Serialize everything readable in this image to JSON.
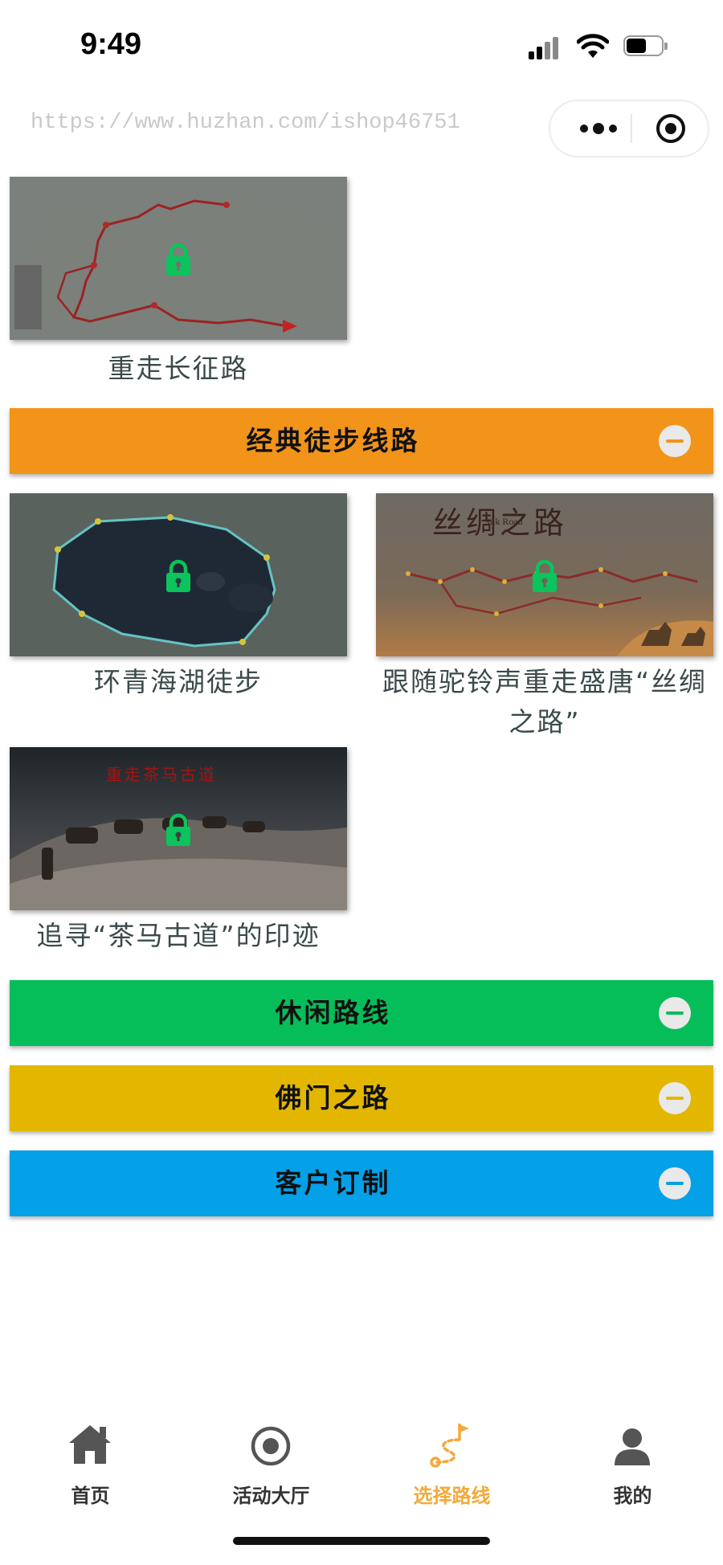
{
  "status_bar": {
    "time": "9:49"
  },
  "watermark": "https://www.huzhan.com/ishop46751",
  "sections": {
    "first_group": {
      "cards": [
        {
          "caption": "重走长征路",
          "image": "long-march-map"
        }
      ]
    },
    "hiking": {
      "title": "经典徒步线路",
      "color": "#F2941A",
      "cards": [
        {
          "caption": "环青海湖徒步",
          "image": "qinghai-lake-map"
        },
        {
          "caption": "跟随驼铃声重走盛唐“丝绸之路”",
          "image": "silk-road-map",
          "overlay_title": "丝绸之路",
          "overlay_sub": "Silk Road"
        },
        {
          "caption": "追寻“茶马古道”的印迹",
          "image": "tea-horse-road-photo",
          "overlay_title": "重走茶马古道"
        }
      ]
    },
    "leisure": {
      "title": "休闲路线",
      "color": "#05BE5A"
    },
    "buddhist": {
      "title": "佛门之路",
      "color": "#E3B700"
    },
    "custom": {
      "title": "客户订制",
      "color": "#04A0E8"
    }
  },
  "tabbar": {
    "active_color": "#F3A93A",
    "items": [
      {
        "label": "首页",
        "icon": "home-icon",
        "active": false
      },
      {
        "label": "活动大厅",
        "icon": "target-icon",
        "active": false
      },
      {
        "label": "选择路线",
        "icon": "route-flag-icon",
        "active": true
      },
      {
        "label": "我的",
        "icon": "user-icon",
        "active": false
      }
    ]
  }
}
